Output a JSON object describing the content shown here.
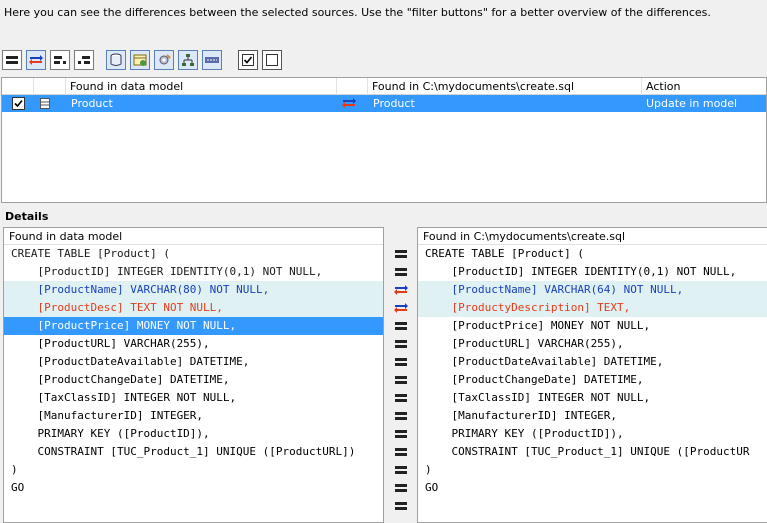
{
  "intro_text": "Here you can see the differences between the selected sources. Use the \"filter buttons\" for a better overview of the differences.",
  "toolbar": {
    "buttons": [
      "equal-filter-icon",
      "differences-filter-icon",
      "only-left-filter-icon",
      "only-right-filter-icon",
      "database-icon",
      "table-icon",
      "settings-icon",
      "tree-icon",
      "key-icon",
      "check-all-icon",
      "uncheck-all-icon"
    ]
  },
  "grid": {
    "headers": {
      "model": "Found in data model",
      "file": "Found in C:\\mydocuments\\create.sql",
      "action": "Action"
    },
    "rows": [
      {
        "checked": true,
        "model": "Product",
        "file": "Product",
        "action": "Update in model",
        "status": "different"
      }
    ]
  },
  "details": {
    "label": "Details",
    "left_title": "Found in data model",
    "right_title": "Found in C:\\mydocuments\\create.sql",
    "left_lines": [
      "CREATE TABLE [Product] (",
      "    [ProductID] INTEGER IDENTITY(0,1) NOT NULL,",
      "    [ProductName] VARCHAR(80) NOT NULL,",
      "    [ProductDesc] TEXT NOT NULL,",
      "    [ProductPrice] MONEY NOT NULL,",
      "    [ProductURL] VARCHAR(255),",
      "    [ProductDateAvailable] DATETIME,",
      "    [ProductChangeDate] DATETIME,",
      "    [TaxClassID] INTEGER NOT NULL,",
      "    [ManufacturerID] INTEGER,",
      "    PRIMARY KEY ([ProductID]),",
      "    CONSTRAINT [TUC_Product_1] UNIQUE ([ProductURL])",
      ")",
      "GO"
    ],
    "right_lines": [
      "CREATE TABLE [Product] (",
      "    [ProductID] INTEGER IDENTITY(0,1) NOT NULL,",
      "    [ProductName] VARCHAR(64) NOT NULL,",
      "    [ProductyDescription] TEXT,",
      "    [ProductPrice] MONEY NOT NULL,",
      "    [ProductURL] VARCHAR(255),",
      "    [ProductDateAvailable] DATETIME,",
      "    [ProductChangeDate] DATETIME,",
      "    [TaxClassID] INTEGER NOT NULL,",
      "    [ManufacturerID] INTEGER,",
      "    PRIMARY KEY ([ProductID]),",
      "    CONSTRAINT [TUC_Product_1] UNIQUE ([ProductUR",
      ")",
      "GO"
    ],
    "line_status": [
      "equal",
      "equal",
      "different",
      "different",
      "equal",
      "equal",
      "equal",
      "equal",
      "equal",
      "equal",
      "equal",
      "equal",
      "equal",
      "equal"
    ],
    "selected_line": 4
  },
  "colors": {
    "selection": "#3399ff",
    "changed_row": "#dff1f3",
    "diff_text": "#e63a1a",
    "keyword_blue": "#1a3fbf"
  }
}
